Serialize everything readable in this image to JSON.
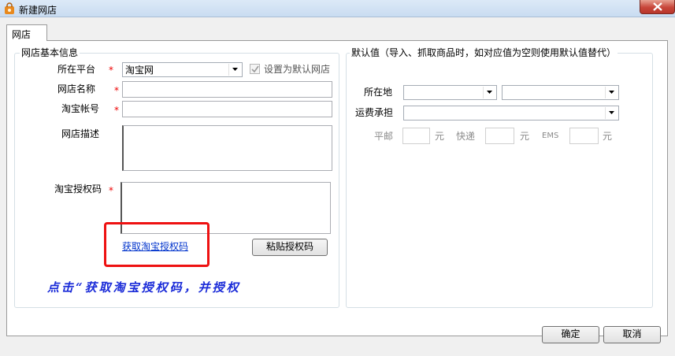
{
  "window": {
    "title": "新建网店",
    "app_icon": "shopping-bag-icon",
    "close_icon": "close-icon"
  },
  "tabs": [
    {
      "label": "网店"
    }
  ],
  "basic_info": {
    "title": "网店基本信息",
    "platform_label": "所在平台",
    "platform_value": "淘宝网",
    "default_shop_label": "设置为默认网店",
    "shop_name_label": "网店名称",
    "account_label": "淘宝帐号",
    "description_label": "网店描述",
    "auth_code_label": "淘宝授权码",
    "required_mark": "*",
    "get_auth_link": "获取淘宝授权码",
    "paste_button": "粘贴授权码"
  },
  "defaults": {
    "title": "默认值（导入、抓取商品时，如对应值为空则使用默认值替代）",
    "location_label": "所在地",
    "shipping_label": "运费承担",
    "mail_label": "平邮",
    "express_label": "快递",
    "ems_label": "EMS",
    "unit": "元"
  },
  "annotation": "点击“获取淘宝授权码，并授权",
  "footer": {
    "ok_button": "确定",
    "cancel_button": "取消"
  },
  "colors": {
    "highlight": "#ee1111",
    "annotation": "#1a2bd8",
    "required": "#ee0000"
  }
}
